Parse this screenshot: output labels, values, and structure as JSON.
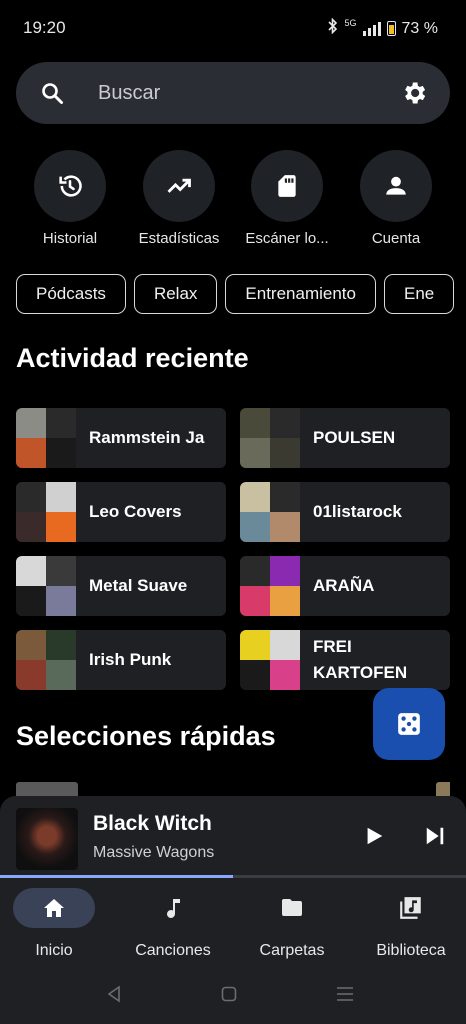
{
  "status_bar": {
    "time": "19:20",
    "network": "5G",
    "battery": "73 %"
  },
  "search": {
    "placeholder": "Buscar"
  },
  "shortcuts": [
    {
      "label": "Historial",
      "icon": "history-icon"
    },
    {
      "label": "Estadísticas",
      "icon": "trending-up-icon"
    },
    {
      "label": "Escáner lo...",
      "icon": "sd-card-icon"
    },
    {
      "label": "Cuenta",
      "icon": "account-icon"
    }
  ],
  "chips": [
    "Pódcasts",
    "Relax",
    "Entrenamiento",
    "Ene"
  ],
  "recent": {
    "title": "Actividad reciente",
    "items": [
      {
        "name": "Rammstein Ja",
        "colors": [
          "#8c8c86",
          "#2a2a2a",
          "#c0552a",
          "#1a1a1a"
        ]
      },
      {
        "name": "POULSEN",
        "colors": [
          "#4a4a3a",
          "#2a2a2a",
          "#6a6a5a",
          "#3a3a30"
        ]
      },
      {
        "name": "Leo Covers",
        "colors": [
          "#2a2a2a",
          "#d0d0d0",
          "#3a2a2a",
          "#e86a20"
        ]
      },
      {
        "name": "01listarock",
        "colors": [
          "#c8c0a0",
          "#2a2a2a",
          "#6a8a9a",
          "#b08a6a"
        ]
      },
      {
        "name": "Metal Suave",
        "colors": [
          "#d8d8d8",
          "#3a3a3a",
          "#1a1a1a",
          "#7a7a9a"
        ]
      },
      {
        "name": "ARAÑA",
        "colors": [
          "#2a2a2a",
          "#8a2ab0",
          "#d83a6a",
          "#e8a040"
        ]
      },
      {
        "name": "Irish Punk",
        "colors": [
          "#7a5a3a",
          "#2a3a2a",
          "#8a3a2a",
          "#5a6a5a"
        ]
      },
      {
        "name": "FREI KARTOFEN",
        "colors": [
          "#e8d020",
          "#d8d8d8",
          "#1a1a1a",
          "#d8408a"
        ]
      }
    ]
  },
  "quick_picks": {
    "title": "Selecciones rápidas"
  },
  "player": {
    "title": "Black Witch",
    "artist": "Massive Wagons",
    "progress": 0.5
  },
  "nav": [
    {
      "label": "Inicio",
      "icon": "home-icon",
      "active": true
    },
    {
      "label": "Canciones",
      "icon": "music-note-icon",
      "active": false
    },
    {
      "label": "Carpetas",
      "icon": "folder-icon",
      "active": false
    },
    {
      "label": "Biblioteca",
      "icon": "library-music-icon",
      "active": false
    }
  ]
}
